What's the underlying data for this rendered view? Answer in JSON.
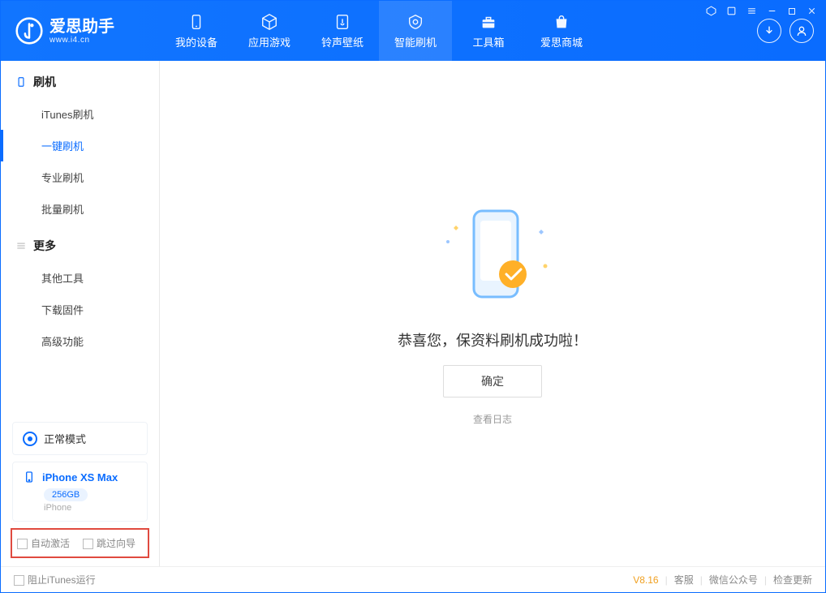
{
  "app": {
    "title": "爱思助手",
    "subtitle": "www.i4.cn"
  },
  "nav": {
    "tabs": [
      {
        "label": "我的设备"
      },
      {
        "label": "应用游戏"
      },
      {
        "label": "铃声壁纸"
      },
      {
        "label": "智能刷机"
      },
      {
        "label": "工具箱"
      },
      {
        "label": "爱思商城"
      }
    ]
  },
  "sidebar": {
    "section1": {
      "title": "刷机",
      "items": [
        "iTunes刷机",
        "一键刷机",
        "专业刷机",
        "批量刷机"
      ],
      "active_index": 1
    },
    "section2": {
      "title": "更多",
      "items": [
        "其他工具",
        "下载固件",
        "高级功能"
      ]
    },
    "mode_label": "正常模式",
    "device": {
      "name": "iPhone XS Max",
      "capacity": "256GB",
      "type": "iPhone"
    },
    "checkboxes": {
      "auto_activate": "自动激活",
      "skip_guide": "跳过向导"
    }
  },
  "main": {
    "success_message": "恭喜您，保资料刷机成功啦！",
    "ok_button": "确定",
    "view_log": "查看日志"
  },
  "status": {
    "block_itunes": "阻止iTunes运行",
    "version": "V8.16",
    "links": [
      "客服",
      "微信公众号",
      "检查更新"
    ]
  }
}
